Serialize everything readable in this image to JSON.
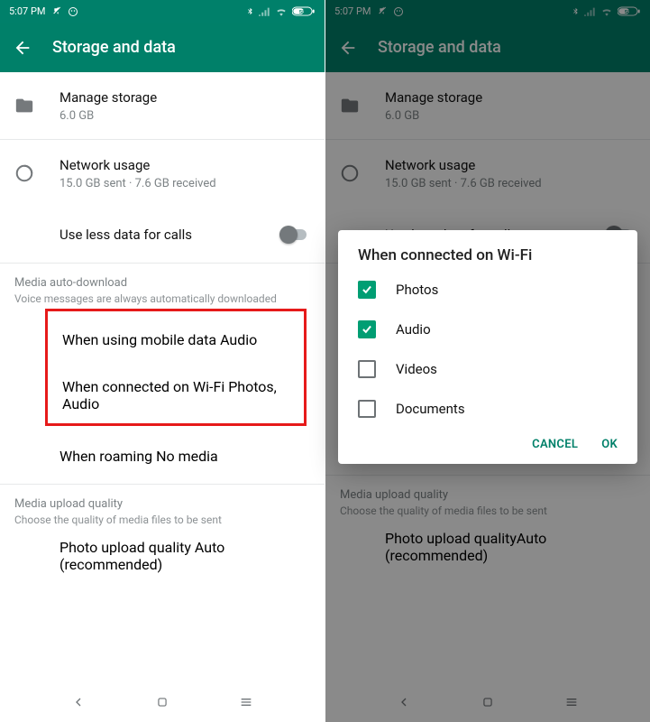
{
  "status": {
    "time": "5:07 PM",
    "icons": {
      "mute": "mute-icon",
      "sticker": "sticker-icon",
      "bt": "bluetooth-icon",
      "signal": "signal-icon",
      "wifi": "wifi-icon",
      "battery": "58"
    }
  },
  "header": {
    "title": "Storage and data"
  },
  "rows": {
    "manage": {
      "title": "Manage storage",
      "sub": "6.0 GB"
    },
    "network": {
      "title": "Network usage",
      "sub": "15.0 GB sent · 7.6 GB received"
    },
    "lessdata": {
      "title": "Use less data for calls"
    }
  },
  "media_section": {
    "header": "Media auto-download",
    "sub": "Voice messages are always automatically downloaded",
    "mobile": {
      "title": "When using mobile data",
      "sub": "Audio"
    },
    "wifi": {
      "title": "When connected on Wi-Fi",
      "sub": "Photos, Audio"
    },
    "roaming": {
      "title": "When roaming",
      "sub": "No media"
    }
  },
  "upload_section": {
    "header": "Media upload quality",
    "sub": "Choose the quality of media files to be sent",
    "photo": {
      "title": "Photo upload quality",
      "sub": "Auto (recommended)"
    }
  },
  "dialog": {
    "title": "When connected on Wi-Fi",
    "options": [
      {
        "label": "Photos",
        "checked": true
      },
      {
        "label": "Audio",
        "checked": true
      },
      {
        "label": "Videos",
        "checked": false
      },
      {
        "label": "Documents",
        "checked": false
      }
    ],
    "cancel": "CANCEL",
    "ok": "OK"
  }
}
